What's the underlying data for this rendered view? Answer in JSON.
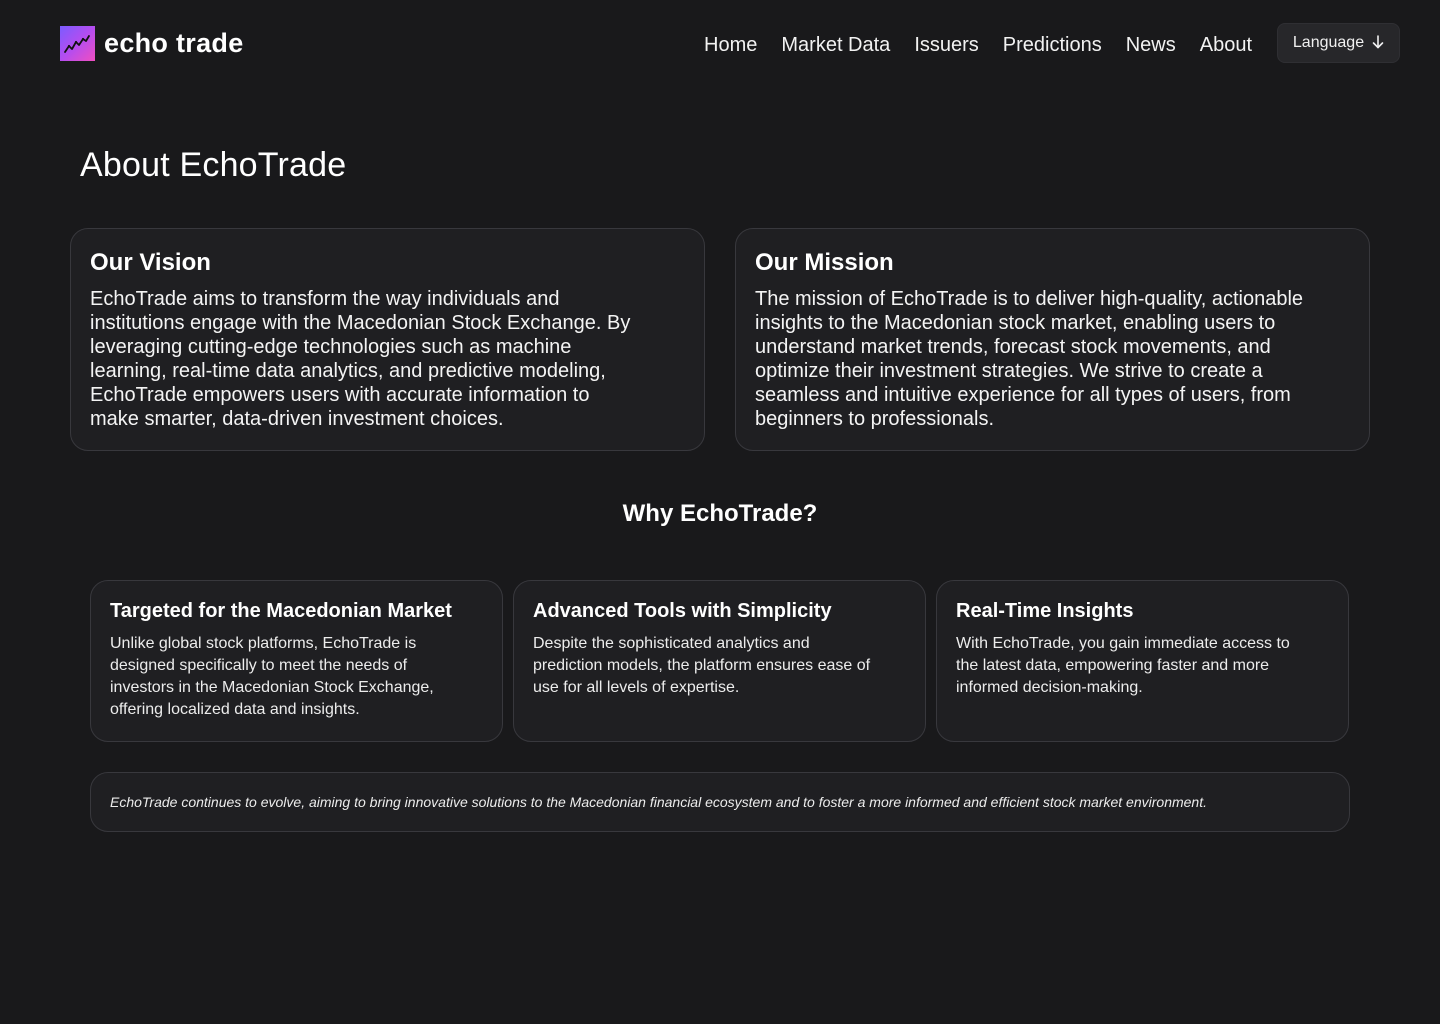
{
  "header": {
    "logo_text": "echo trade",
    "logo_icon": "chart-trend-icon",
    "nav": [
      {
        "label": "Home"
      },
      {
        "label": "Market Data"
      },
      {
        "label": "Issuers"
      },
      {
        "label": "Predictions"
      },
      {
        "label": "News"
      },
      {
        "label": "About"
      }
    ],
    "language_button": {
      "label": "Language",
      "icon": "arrow-down-icon"
    }
  },
  "page_title": "About EchoTrade",
  "vision": {
    "title": "Our Vision",
    "text": "EchoTrade aims to transform the way individuals and\ninstitutions engage  with the Macedonian Stock Exchange. By\nleveraging cutting-edge  technologies such as machine\nlearning, real-time data analytics, and  predictive modeling,\nEchoTrade empowers users with accurate information  to\nmake smarter, data-driven investment choices."
  },
  "mission": {
    "title": "Our Mission",
    "text": "The mission of EchoTrade is to  deliver high-quality, actionable\ninsights to the Macedonian stock  market, enabling users to\nunderstand market trends, forecast stock  movements, and\noptimize their investment strategies. We strive to create a\nseamless and intuitive experience for all types of users, from\nbeginners to professionals."
  },
  "why": {
    "title": "Why EchoTrade?",
    "cards": [
      {
        "title": "Targeted for the Macedonian Market",
        "text": "Unlike global stock platforms, EchoTrade is\ndesigned specifically to  meet the needs of\ninvestors in the Macedonian Stock Exchange,\noffering  localized data and insights."
      },
      {
        "title": "Advanced Tools with Simplicity",
        "text": "Despite the sophisticated analytics and\nprediction models, the platform ensures ease of\nuse for all levels of expertise."
      },
      {
        "title": "Real-Time Insights",
        "text": "With EchoTrade, you gain immediate access to\nthe latest data, empowering faster and more\ninformed decision-making."
      }
    ]
  },
  "closing_note": "EchoTrade continues to evolve, aiming to bring innovative solutions to  the Macedonian financial ecosystem and to foster a more informed and  efficient stock market environment.",
  "colors": {
    "background": "#19191b",
    "card": "#1f1f22",
    "card_border": "#38383d",
    "logo_gradient_start": "#7b5cff",
    "logo_gradient_end": "#f04fc0"
  }
}
